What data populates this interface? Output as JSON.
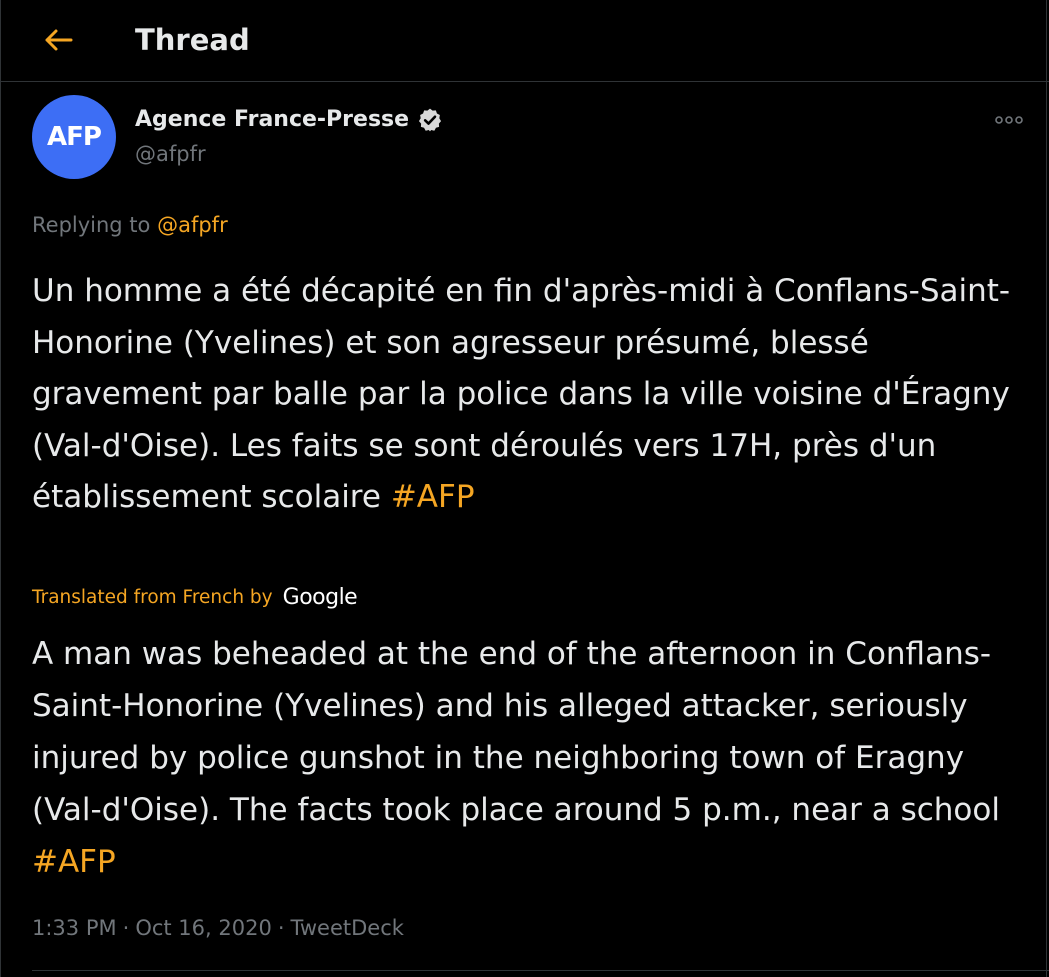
{
  "header": {
    "back_icon": "arrow-left-icon",
    "title": "Thread"
  },
  "colors": {
    "accent": "#f5a623",
    "avatar_bg": "#3d6ef5",
    "text_primary": "#e7e9ea",
    "text_secondary": "#71767b",
    "background": "#000000"
  },
  "tweet": {
    "avatar_text": "AFP",
    "author_name": "Agence France-Presse",
    "verified_icon": "verified-badge-icon",
    "handle": "@afpfr",
    "more_icon": "more-options-icon",
    "replying_prefix": "Replying to",
    "replying_handle": "@afpfr",
    "text": "Un homme a été décapité en fin d'après-midi à Conflans-Saint-Honorine (Yvelines) et son agresseur présumé, blessé gravement par balle par la police dans la ville voisine d'Éragny (Val-d'Oise). Les faits se sont déroulés vers 17H, près d'un établissement scolaire",
    "hashtag": "#AFP",
    "translated_label": "Translated from French by",
    "translator": "Google",
    "translation_text": "A man was beheaded at the end of the afternoon in Conflans-Saint-Honorine (Yvelines) and his alleged attacker, seriously injured by police gunshot in the neighboring town of Eragny (Val-d'Oise). The facts took place around 5 p.m., near a school",
    "translation_hashtag": "#AFP",
    "time": "1:33 PM",
    "date": "Oct 16, 2020",
    "source": "TweetDeck",
    "meta_separator": "·"
  }
}
